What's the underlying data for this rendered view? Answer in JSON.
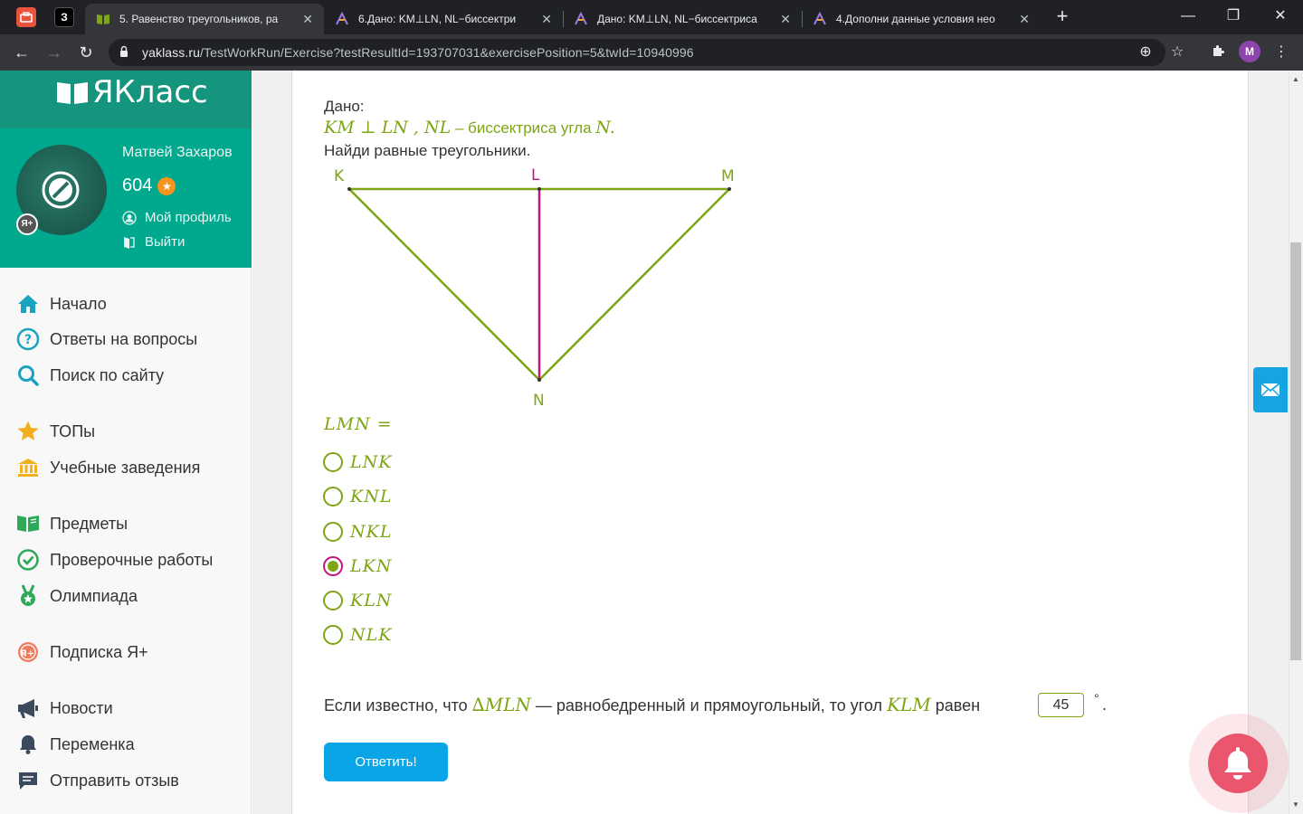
{
  "browser": {
    "tabs": [
      {
        "title": "5. Равенство треугольников, ра",
        "active": true
      },
      {
        "title": "6.Дано: KM⊥LN, NL−биссектри",
        "active": false
      },
      {
        "title": "Дано: KM⊥LN, NL−биссектриса",
        "active": false
      },
      {
        "title": "4.Дополни данные условия нео",
        "active": false
      }
    ],
    "pinned_tab_label": "З",
    "new_tab": "+",
    "window_controls": {
      "minimize": "—",
      "restore": "❐",
      "close": "✕"
    },
    "url_host": "yaklass.ru",
    "url_path": "/TestWorkRun/Exercise?testResultId=193707031&exercisePosition=5&twId=10940996",
    "profile_initial": "M"
  },
  "sidebar": {
    "logo_text": "ЯКласс",
    "user_name": "Матвей Захаров",
    "points": "604",
    "yaplus_badge": "Я+",
    "profile_link": "Мой профиль",
    "logout_link": "Выйти",
    "menu": [
      {
        "label": "Начало",
        "icon": "home-icon"
      },
      {
        "label": "Ответы на вопросы",
        "icon": "question-icon"
      },
      {
        "label": "Поиск по сайту",
        "icon": "search-icon"
      },
      {
        "label": "ТОПы",
        "icon": "star-icon"
      },
      {
        "label": "Учебные заведения",
        "icon": "institution-icon"
      },
      {
        "label": "Предметы",
        "icon": "books-icon"
      },
      {
        "label": "Проверочные работы",
        "icon": "check-icon"
      },
      {
        "label": "Олимпиада",
        "icon": "medal-icon"
      },
      {
        "label": "Подписка Я+",
        "icon": "subscription-icon"
      },
      {
        "label": "Новости",
        "icon": "megaphone-icon"
      },
      {
        "label": "Переменка",
        "icon": "bell-icon"
      },
      {
        "label": "Отправить отзыв",
        "icon": "feedback-icon"
      }
    ]
  },
  "exercise": {
    "given_label": "Дано:",
    "given_math_1": "KM ⊥ LN",
    "given_math_2": "NL",
    "given_text": " – биссектриса угла ",
    "given_math_3": "N.",
    "task": "Найди равные треугольники.",
    "diagram": {
      "labels": {
        "K": "K",
        "L": "L",
        "M": "M",
        "N": "N"
      },
      "colors": {
        "triangle": "#7da515",
        "bisector": "#c8137e"
      }
    },
    "question_math": "LMN =",
    "options": [
      {
        "label": "LNK",
        "selected": false
      },
      {
        "label": "KNL",
        "selected": false
      },
      {
        "label": "NKL",
        "selected": false
      },
      {
        "label": "LKN",
        "selected": true
      },
      {
        "label": "KLN",
        "selected": false
      },
      {
        "label": "NLK",
        "selected": false
      }
    ],
    "sentence_part1": "Если известно, что ",
    "sentence_math1": "∆MLN",
    "sentence_part2": " — равнобедренный и прямоугольный, то угол ",
    "sentence_math2": "KLM",
    "sentence_part3": " равен",
    "answer_value": "45",
    "degree": "°",
    "end_dot": ".",
    "submit_label": "Ответить!"
  },
  "colors": {
    "accent_green": "#7da515",
    "brand_teal": "#00a88e",
    "button_blue": "#09a5e6",
    "magenta": "#c8137e"
  }
}
